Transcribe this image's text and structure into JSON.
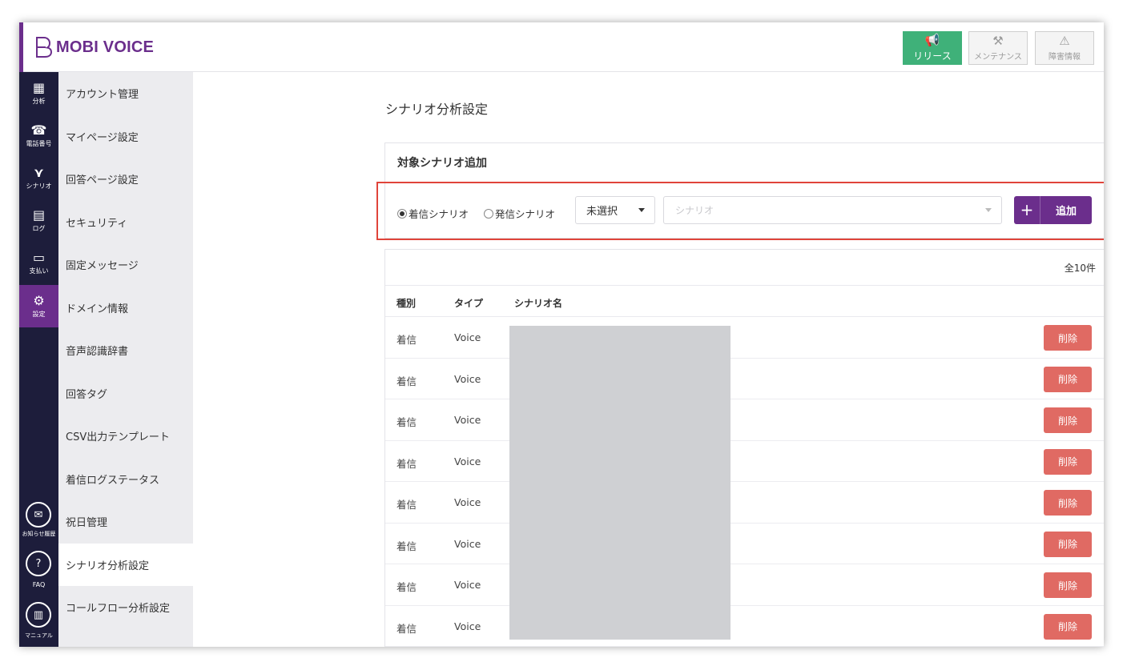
{
  "app": {
    "name": "MOBI VOICE",
    "colors": {
      "brand": "#6b2e8c",
      "rail": "#1d1d3b",
      "release": "#3fb179",
      "danger": "#e06a63",
      "highlight": "#e0443a"
    }
  },
  "header": {
    "buttons": [
      {
        "label": "リリース",
        "icon": "megaphone-icon"
      },
      {
        "label": "メンテナンス",
        "icon": "tools-icon"
      },
      {
        "label": "障害情報",
        "icon": "warning-icon"
      }
    ]
  },
  "rail": {
    "items": [
      {
        "label": "分析",
        "icon": "dashboard-icon"
      },
      {
        "label": "電話番号",
        "icon": "phone-icon"
      },
      {
        "label": "シナリオ",
        "icon": "branch-icon"
      },
      {
        "label": "ログ",
        "icon": "document-icon"
      },
      {
        "label": "支払い",
        "icon": "card-icon"
      },
      {
        "label": "設定",
        "icon": "gear-icon"
      }
    ],
    "bottom": [
      {
        "label": "お知らせ履歴",
        "icon": "mail-icon"
      },
      {
        "label": "FAQ",
        "icon": "help-icon"
      },
      {
        "label": "マニュアル",
        "icon": "book-icon"
      }
    ]
  },
  "submenu": {
    "items": [
      "アカウント管理",
      "マイページ設定",
      "回答ページ設定",
      "セキュリティ",
      "固定メッセージ",
      "ドメイン情報",
      "音声認識辞書",
      "回答タグ",
      "CSV出力テンプレート",
      "着信ログステータス",
      "祝日管理",
      "シナリオ分析設定",
      "コールフロー分析設定"
    ],
    "active": "シナリオ分析設定"
  },
  "page": {
    "title": "シナリオ分析設定",
    "add_card": {
      "title": "対象シナリオ追加",
      "radio_incoming": "着信シナリオ",
      "radio_outgoing": "発信シナリオ",
      "selected_radio": "着信シナリオ",
      "type_select_value": "未選択",
      "scenario_placeholder": "シナリオ",
      "add_button_plus": "+",
      "add_button_label": "追加"
    },
    "list": {
      "total": "全10件",
      "columns": [
        "種別",
        "タイプ",
        "シナリオ名"
      ],
      "rows": [
        {
          "kind": "着信",
          "type": "Voice",
          "delete": "削除"
        },
        {
          "kind": "着信",
          "type": "Voice",
          "delete": "削除"
        },
        {
          "kind": "着信",
          "type": "Voice",
          "delete": "削除"
        },
        {
          "kind": "着信",
          "type": "Voice",
          "delete": "削除"
        },
        {
          "kind": "着信",
          "type": "Voice",
          "delete": "削除"
        },
        {
          "kind": "着信",
          "type": "Voice",
          "delete": "削除"
        },
        {
          "kind": "着信",
          "type": "Voice",
          "delete": "削除"
        },
        {
          "kind": "着信",
          "type": "Voice",
          "delete": "削除"
        }
      ]
    }
  }
}
